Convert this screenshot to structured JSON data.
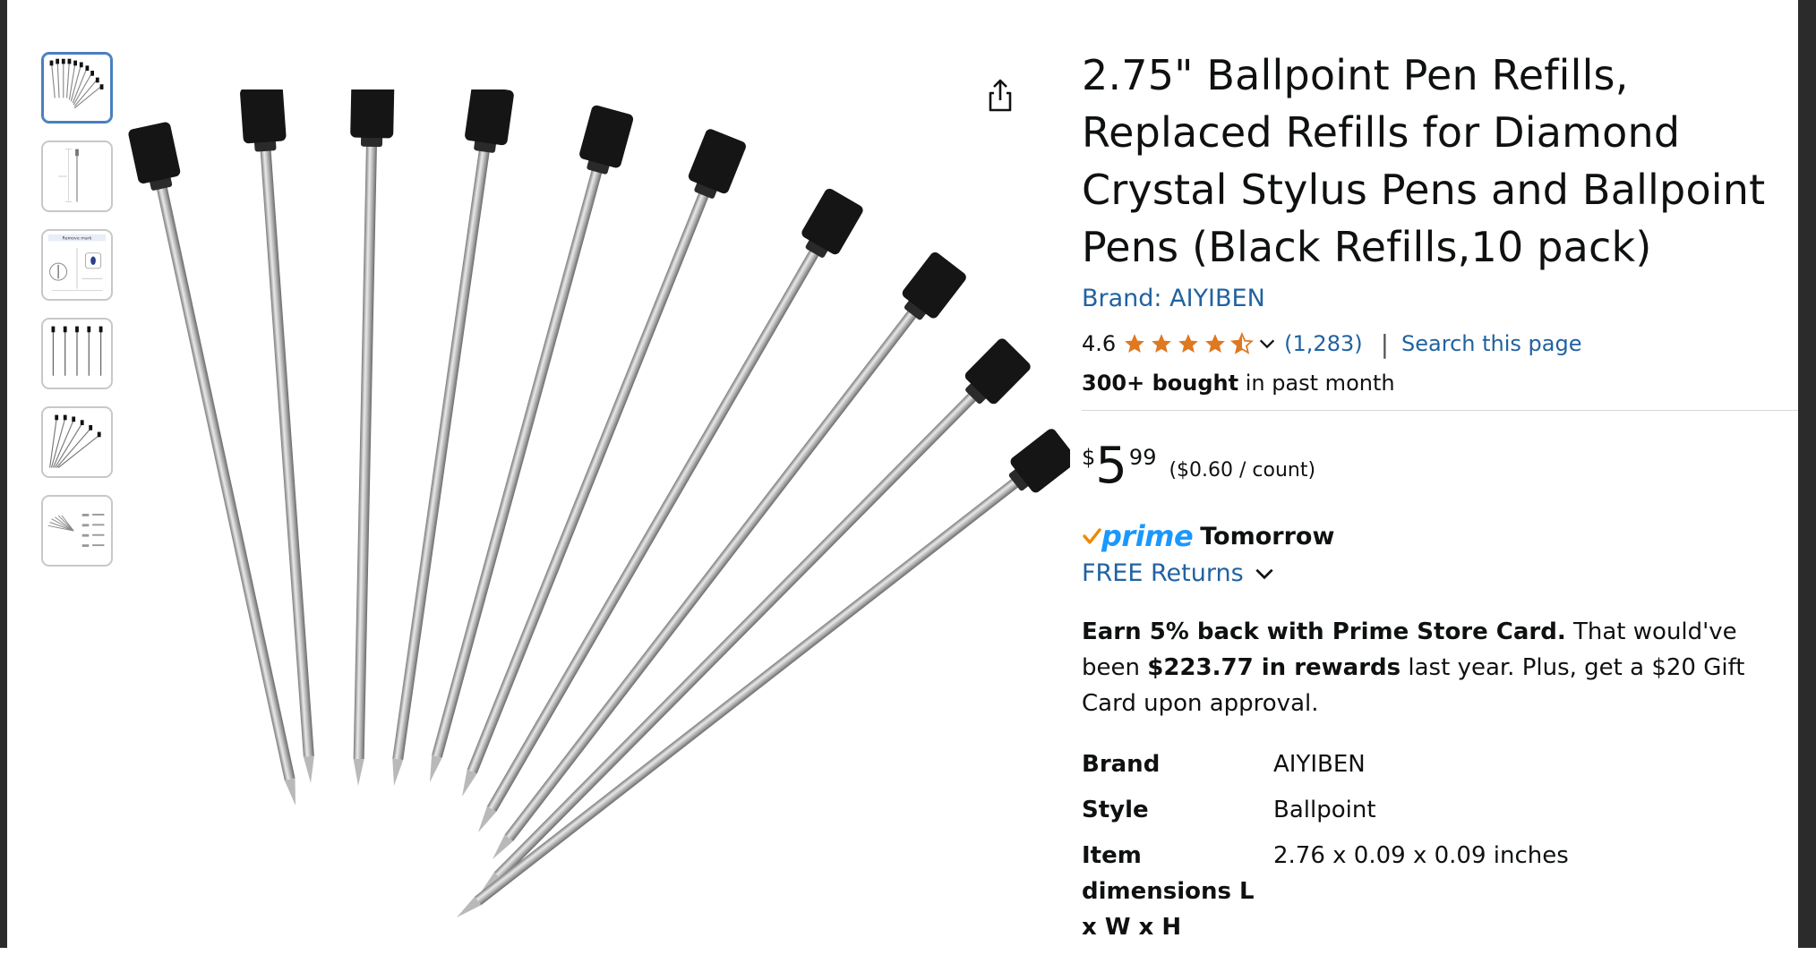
{
  "product": {
    "title": "2.75\" Ballpoint Pen Refills, Replaced Refills for Diamond Crystal Stylus Pens and Ballpoint Pens (Black Refills,10 pack)",
    "brand_link": "Brand: AIYIBEN",
    "rating": "4.6",
    "rating_value": 4.6,
    "review_count": "(1,283)",
    "search_link": "Search this page",
    "separator": "|",
    "bought_bold": "300+ bought",
    "bought_rest": " in past month",
    "price": {
      "symbol": "$",
      "whole": "5",
      "fraction": "99",
      "per_unit": "($0.60 / count)"
    },
    "delivery": {
      "prime_label": "prime",
      "day": "Tomorrow",
      "returns": "FREE Returns"
    },
    "offer": {
      "bold1": "Earn 5% back with Prime Store Card.",
      "text1": " That would've been ",
      "bold2": "$223.77 in rewards",
      "text2": " last year. Plus, get a $20 Gift Card upon approval."
    },
    "specs": [
      {
        "key": "Brand",
        "value": "AIYIBEN"
      },
      {
        "key": "Style",
        "value": "Ballpoint"
      },
      {
        "key": "Item dimensions L x W x H",
        "value": "2.76 x 0.09 x 0.09 inches"
      }
    ]
  },
  "gallery": {
    "thumbnail_count": 6,
    "active_index": 0,
    "refill_count": 10,
    "thumbnail_captions": [
      "Remove mark"
    ]
  },
  "colors": {
    "link": "#2162a1",
    "star": "#de7921",
    "prime_blue": "#1a98ff",
    "prime_check": "#f08804"
  },
  "icons": [
    "share-icon",
    "star-icon",
    "chevron-down-icon",
    "prime-check-icon"
  ]
}
